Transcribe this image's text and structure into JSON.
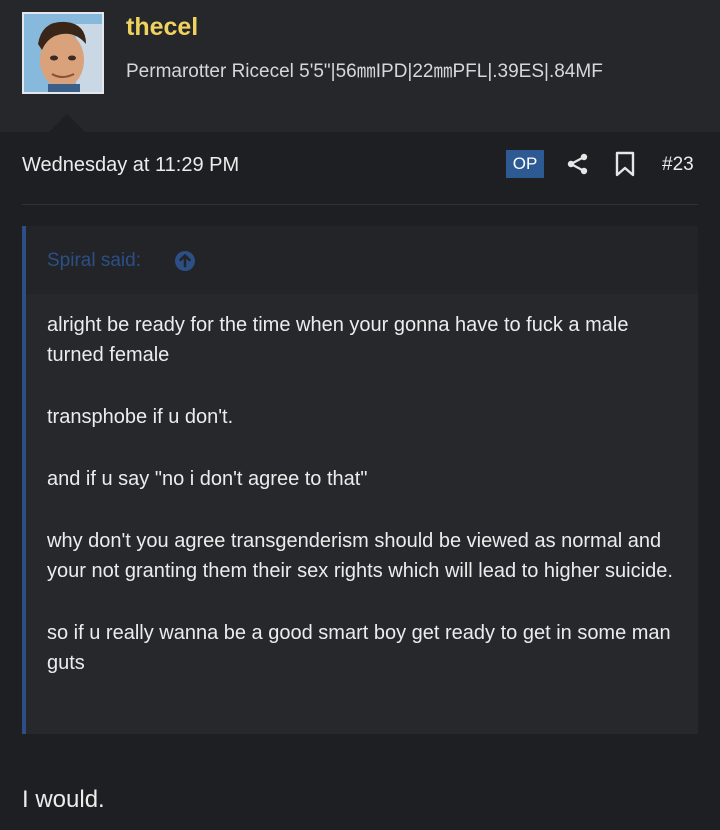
{
  "user": {
    "name": "thecel",
    "title": "Permarotter Ricecel 5'5\"|56㎜IPD|22㎜PFL|.39ES|.84MF"
  },
  "post": {
    "date": "Wednesday at 11:29 PM",
    "op_badge": "OP",
    "number": "#23",
    "quote": {
      "author": "Spiral said:",
      "paragraphs": [
        "alright be ready for the time when your gonna have to fuck a male turned female",
        "transphobe if u don't.",
        "and if u say \"no i don't agree to that\"",
        "why don't you agree transgenderism should be viewed as normal and your not granting them their sex rights which will lead to higher suicide.",
        "so if u really wanna be a good smart boy get ready to get in some man guts"
      ]
    },
    "reply": "I would."
  },
  "icons": {
    "share": "share-icon",
    "bookmark": "bookmark-icon",
    "quote_link": "arrow-up-circle-icon"
  },
  "colors": {
    "username": "#f0d25e",
    "accent": "#2c4f86",
    "background": "#1e1f22"
  }
}
